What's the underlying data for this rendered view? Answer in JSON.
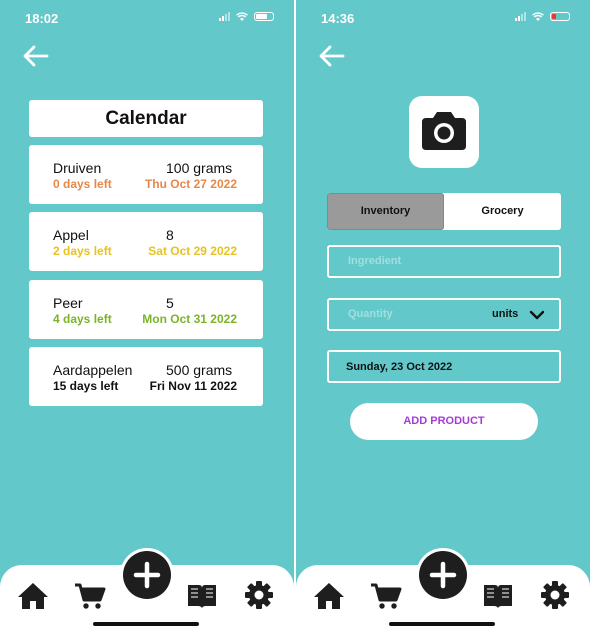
{
  "left": {
    "status_time": "18:02",
    "title": "Calendar",
    "items": [
      {
        "name": "Druiven",
        "qty": "100 grams",
        "days_left": "0 days left",
        "date": "Thu Oct 27 2022",
        "color": "#e8874a"
      },
      {
        "name": "Appel",
        "qty": "8",
        "days_left": "2 days left",
        "date": "Sat Oct 29 2022",
        "color": "#e9c21f"
      },
      {
        "name": "Peer",
        "qty": "5",
        "days_left": "4 days left",
        "date": "Mon Oct 31 2022",
        "color": "#7ab527"
      },
      {
        "name": "Aardappelen",
        "qty": "500 grams",
        "days_left": "15 days left",
        "date": "Fri Nov 11 2022",
        "color": "#111111"
      }
    ]
  },
  "right": {
    "status_time": "14:36",
    "tabs": {
      "inventory": "Inventory",
      "grocery": "Grocery"
    },
    "ingredient_placeholder": "Ingredient",
    "quantity_placeholder": "Quantity",
    "units_label": "units",
    "date_value": "Sunday, 23 Oct 2022",
    "add_button": "ADD PRODUCT"
  },
  "nav_icons": [
    "home-icon",
    "cart-icon",
    "plus-icon",
    "book-icon",
    "gear-icon"
  ],
  "colors": {
    "background": "#63c8ca",
    "accent_purple": "#a73bd6",
    "dark": "#1e1e1e"
  }
}
